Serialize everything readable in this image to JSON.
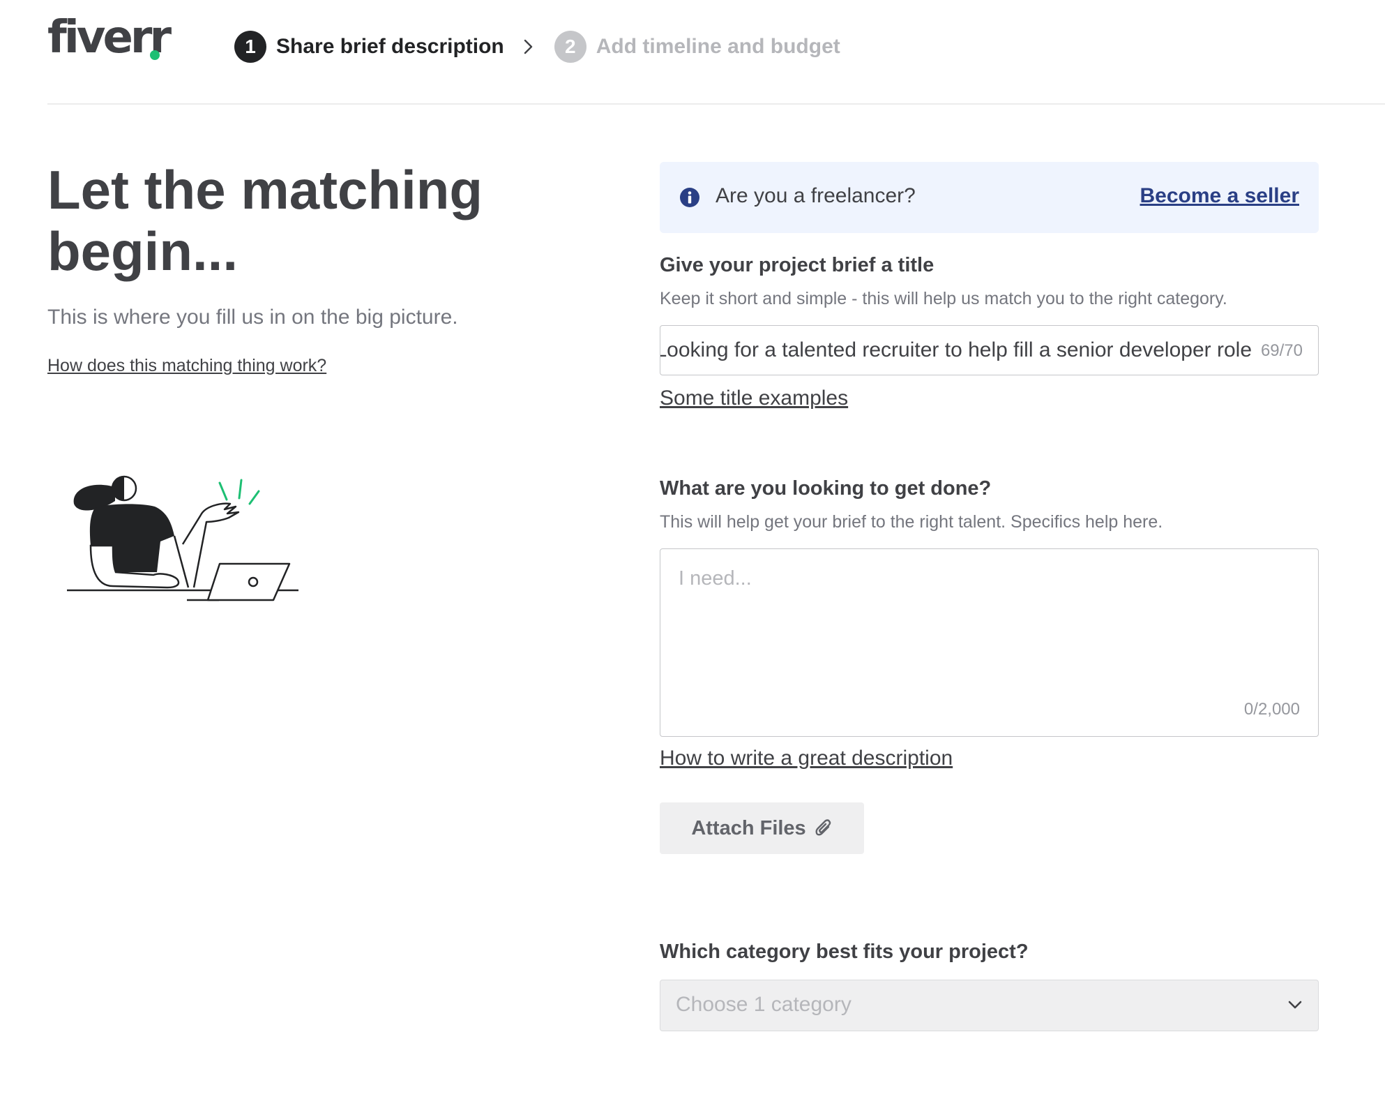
{
  "header": {
    "logo_text": "fiverr",
    "steps": [
      {
        "number": "1",
        "label": "Share brief description",
        "state": "active"
      },
      {
        "number": "2",
        "label": "Add timeline and budget",
        "state": "inactive"
      }
    ]
  },
  "hero": {
    "title": "Let the matching begin...",
    "subtitle": "This is where you fill us in on the big picture.",
    "help_link": "How does this matching thing work?"
  },
  "banner": {
    "text": "Are you a freelancer?",
    "link": "Become a seller",
    "icon": "info-icon"
  },
  "title_field": {
    "label": "Give your project brief a title",
    "help": "Keep it short and simple - this will help us match you to the right category.",
    "value": "Looking for a talented recruiter to help fill a senior developer role",
    "counter": "69/70",
    "examples_link": "Some title examples"
  },
  "description_field": {
    "label": "What are you looking to get done?",
    "help": "This will help get your brief to the right talent. Specifics help here.",
    "placeholder": "I need...",
    "counter": "0/2,000",
    "guide_link": "How to write a great description"
  },
  "attach": {
    "label": "Attach Files",
    "icon": "paperclip-icon"
  },
  "category_field": {
    "label": "Which category best fits your project?",
    "selected": "Choose 1 category",
    "icon": "chevron-down-icon"
  },
  "colors": {
    "brand_green": "#1dbf73",
    "banner_bg": "#eff4fe",
    "link_blue": "#2a3f85",
    "text_dark": "#404145",
    "text_muted": "#74767e"
  }
}
